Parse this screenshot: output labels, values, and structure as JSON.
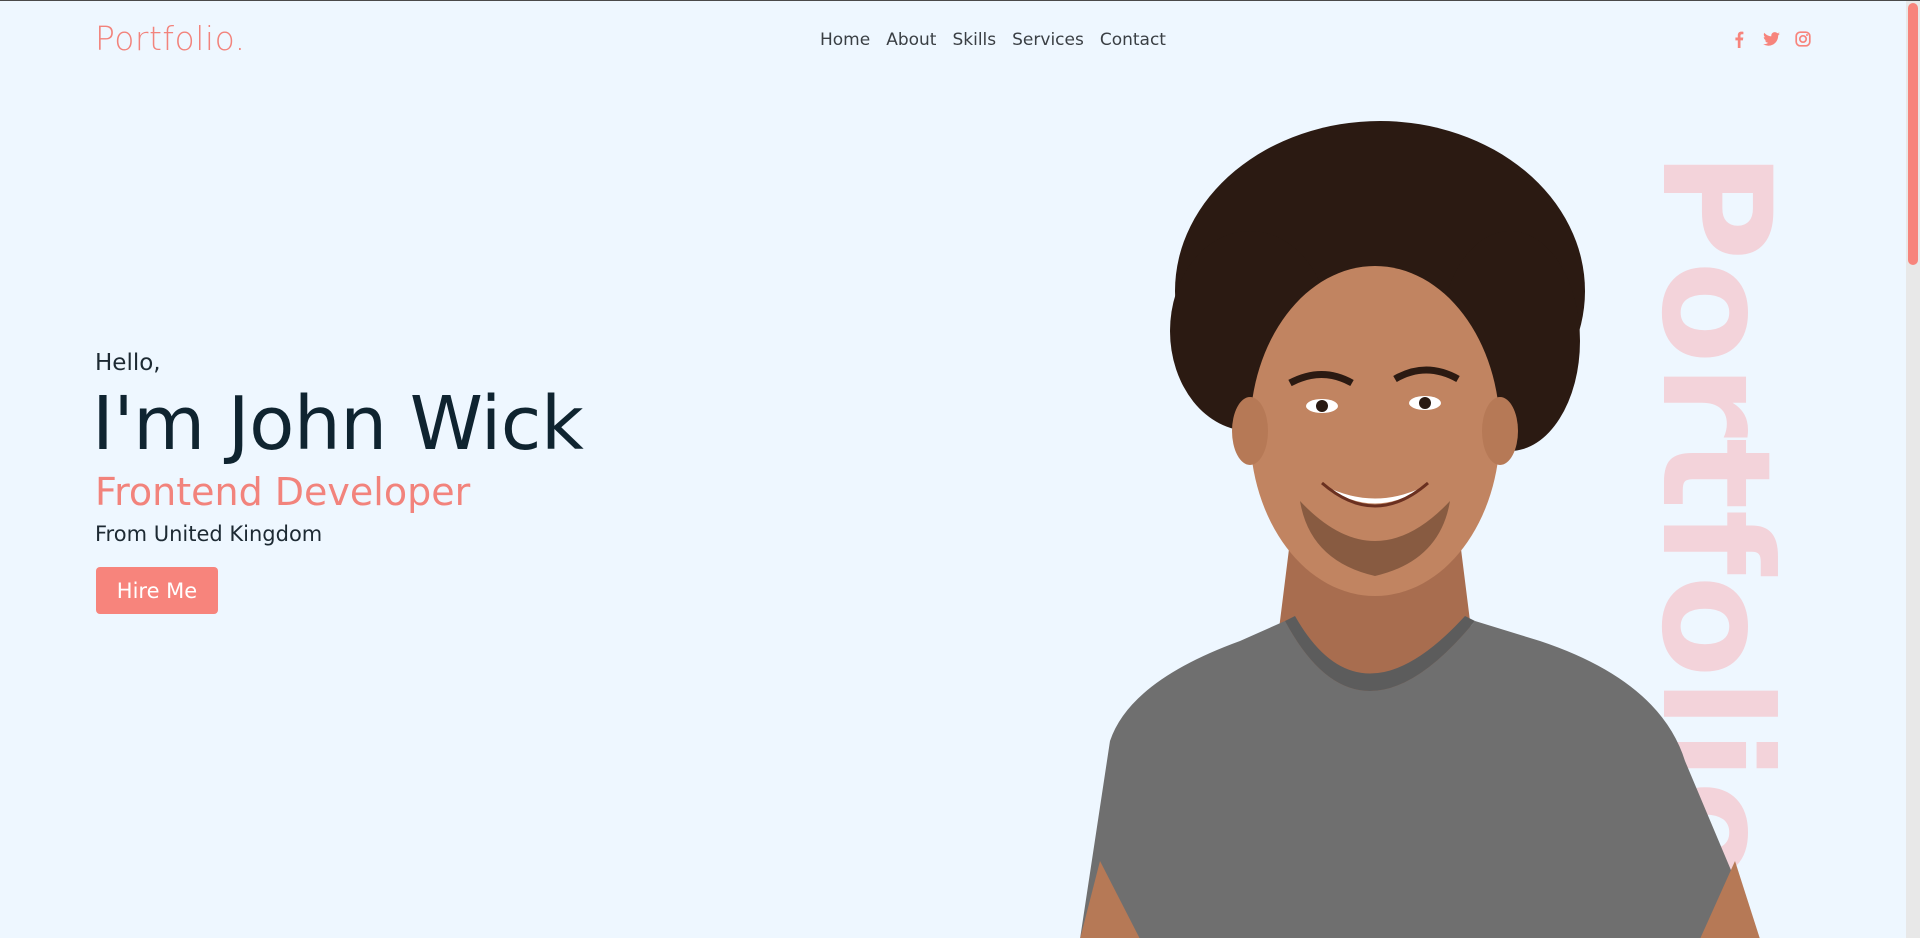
{
  "header": {
    "logo": "Portfolio.",
    "nav": [
      "Home",
      "About",
      "Skills",
      "Services",
      "Contact"
    ],
    "socials": [
      "facebook-icon",
      "twitter-icon",
      "instagram-icon"
    ]
  },
  "hero": {
    "greeting": "Hello,",
    "name": "I'm John Wick",
    "role": "Frontend Developer",
    "location": "From United Kingdom",
    "cta": "Hire Me",
    "watermark": "Portfolio"
  },
  "colors": {
    "accent": "#f7847c",
    "background": "#eef7ff",
    "heading": "#0f2430",
    "watermark": "#f3d3da"
  }
}
